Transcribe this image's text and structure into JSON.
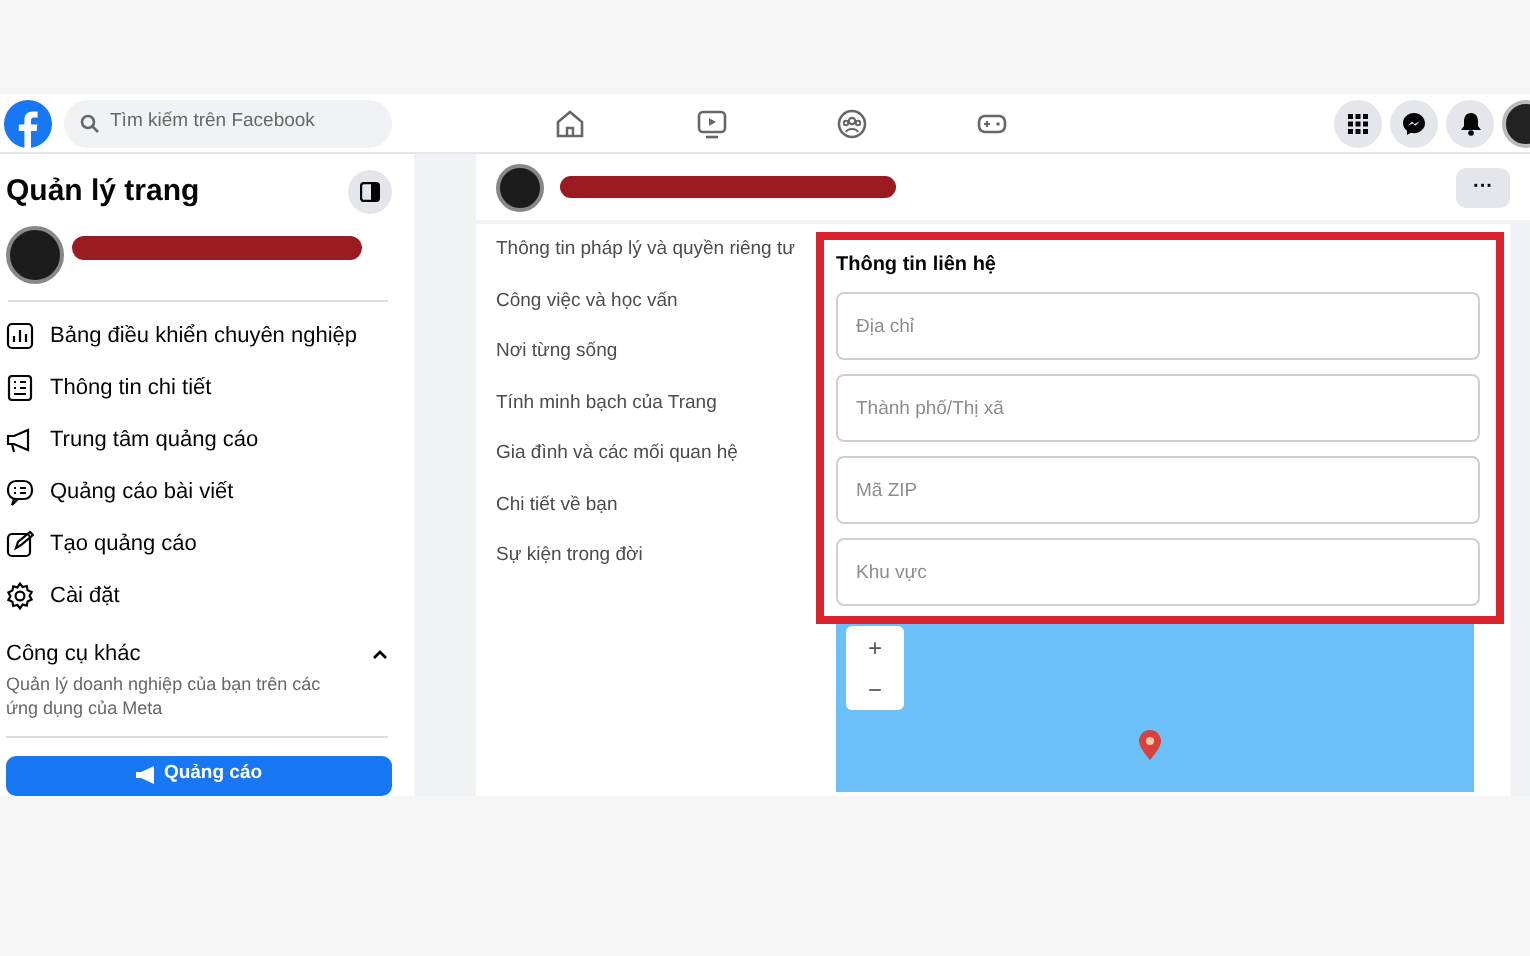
{
  "topbar": {
    "search": {
      "placeholder": "Tìm kiếm trên Facebook"
    }
  },
  "sidebar": {
    "title": "Quản lý trang",
    "items": [
      {
        "label": "Bảng điều khiển chuyên nghiệp"
      },
      {
        "label": "Thông tin chi tiết"
      },
      {
        "label": "Trung tâm quảng cáo"
      },
      {
        "label": "Quảng cáo bài viết"
      },
      {
        "label": "Tạo quảng cáo"
      },
      {
        "label": "Cài đặt"
      }
    ],
    "more_tools": {
      "title": "Công cụ khác",
      "description": "Quản lý doanh nghiệp của bạn trên các ứng dụng của Meta",
      "expanded": true
    },
    "promote_button": "Quảng cáo"
  },
  "about_sections": [
    {
      "label": "Thông tin pháp lý và quyền riêng tư"
    },
    {
      "label": "Công việc và học vấn"
    },
    {
      "label": "Nơi từng sống"
    },
    {
      "label": "Tính minh bạch của Trang"
    },
    {
      "label": "Gia đình và các mối quan hệ"
    },
    {
      "label": "Chi tiết về bạn"
    },
    {
      "label": "Sự kiện trong đời"
    }
  ],
  "contact_info": {
    "title": "Thông tin liên hệ",
    "fields": [
      {
        "placeholder": "Địa chỉ"
      },
      {
        "placeholder": "Thành phố/Thị xã"
      },
      {
        "placeholder": "Mã ZIP"
      },
      {
        "placeholder": "Khu vực"
      }
    ]
  },
  "map": {
    "zoom_in": "+",
    "zoom_out": "−"
  },
  "header_menu": "···"
}
